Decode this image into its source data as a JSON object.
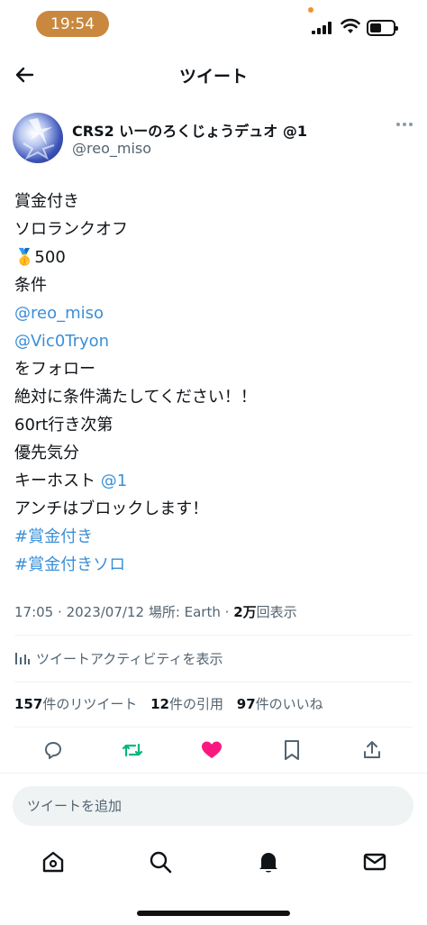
{
  "status_bar": {
    "time": "19:54",
    "accent_color": "#c9883e"
  },
  "header": {
    "title": "ツイート",
    "back_icon": "arrow-left-icon"
  },
  "author": {
    "display_name": "CRS2 いーのろくじょうデュオ @1",
    "handle": "@reo_miso"
  },
  "tweet": {
    "lines": [
      {
        "text": "賞金付き",
        "type": "text"
      },
      {
        "text": "ソロランクオフ",
        "type": "text"
      },
      {
        "text": "🥇500",
        "type": "text"
      },
      {
        "text": "条件",
        "type": "text"
      },
      {
        "text": "@reo_miso",
        "type": "mention"
      },
      {
        "text": "@Vic0Tryon",
        "type": "mention"
      },
      {
        "text": "をフォロー",
        "type": "text"
      },
      {
        "text": "絶対に条件満たしてください！！",
        "type": "text"
      },
      {
        "text": "60rt行き次第",
        "type": "text"
      },
      {
        "text": "優先気分",
        "type": "text"
      },
      {
        "prefix": "キーホスト ",
        "mention": "@1",
        "type": "mixed"
      },
      {
        "text": "アンチはブロックします！",
        "type": "text"
      },
      {
        "text": "#賞金付き",
        "type": "hashtag"
      },
      {
        "text": "#賞金付きソロ",
        "type": "hashtag"
      }
    ]
  },
  "meta": {
    "time": "17:05",
    "date": "2023/07/12",
    "location_label": "場所: Earth",
    "views_count": "2万",
    "views_label": "回表示"
  },
  "activity_label": "ツイートアクティビティを表示",
  "stats": {
    "retweets_count": "157",
    "retweets_label": "件のリツイート",
    "quotes_count": "12",
    "quotes_label": "件の引用",
    "likes_count": "97",
    "likes_label": "件のいいね"
  },
  "actions": {
    "reply_icon": "reply-icon",
    "retweet_icon": "retweet-icon",
    "retweet_color": "#00ba7c",
    "like_icon": "heart-icon",
    "like_color": "#f91880",
    "bookmark_icon": "bookmark-icon",
    "share_icon": "share-icon"
  },
  "reply": {
    "placeholder": "ツイートを追加"
  },
  "tabs": [
    "home-icon",
    "search-icon",
    "notifications-icon",
    "messages-icon"
  ],
  "link_color": "#3a8fd8"
}
